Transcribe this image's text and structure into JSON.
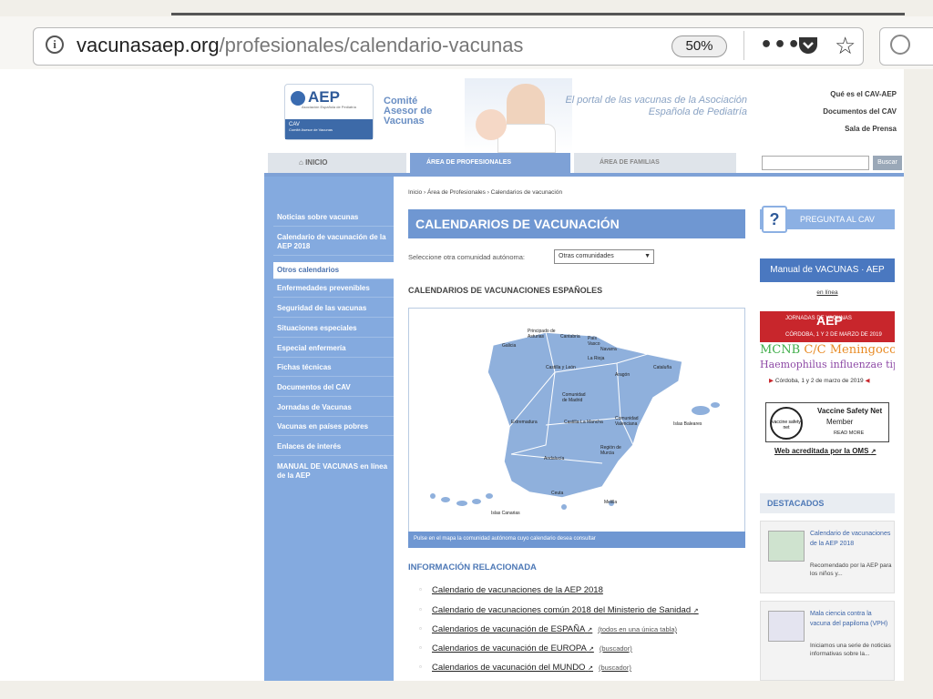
{
  "browser": {
    "url_host": "vacunasaep.org",
    "url_path": "/profesionales/calendario-vacunas",
    "zoom": "50%",
    "menu_dots": "•••"
  },
  "site": {
    "logo_text": "AEP",
    "logo_sub": "Asociación Española de Pediatría",
    "logo_cav": "CAV",
    "logo_cav_sub": "Comité Asesor de Vacunas",
    "comite_lines": [
      "Comité",
      "Asesor de",
      "Vacunas"
    ],
    "tagline": "El portal de las vacunas de la Asociación Española de Pediatría",
    "top_links": [
      "Qué es el CAV-AEP",
      "Documentos del CAV",
      "Sala de Prensa"
    ]
  },
  "nav": {
    "inicio": "INICIO",
    "profesionales": "ÁREA DE PROFESIONALES",
    "familias": "ÁREA DE FAMILIAS",
    "search_button": "Buscar"
  },
  "sidebar": {
    "items": [
      "Noticias sobre vacunas",
      "Calendario de vacunación de la AEP 2018",
      "Otros calendarios",
      "Enfermedades prevenibles",
      "Seguridad de las vacunas",
      "Situaciones especiales",
      "Especial enfermería",
      "Fichas técnicas",
      "Documentos del CAV",
      "Jornadas de Vacunas",
      "Vacunas en países pobres",
      "Enlaces de interés",
      "MANUAL DE VACUNAS en línea de la AEP"
    ]
  },
  "main": {
    "breadcrumb": "Inicio › Área de Profesionales › Calendarios de vacunación",
    "title": "CALENDARIOS DE VACUNACIÓN",
    "select_label": "Seleccione otra comunidad autónoma:",
    "select_value": "Otras comunidades",
    "section_title": "CALENDARIOS DE VACUNACIONES ESPAÑOLES",
    "map_caption": "Pulse en el mapa la comunidad autónoma cuyo calendario desea consultar",
    "map_regions": [
      "Principado de Asturias",
      "Cantabria",
      "País Vasco",
      "Galicia",
      "Navarra",
      "La Rioja",
      "Castilla y León",
      "Aragón",
      "Cataluña",
      "Comunidad de Madrid",
      "Extremadura",
      "Castilla-La Mancha",
      "Comunidad Valenciana",
      "Islas Baleares",
      "Región de Murcia",
      "Andalucía",
      "Ceuta",
      "Melilla",
      "Islas Canarias"
    ],
    "info_title": "INFORMACIÓN RELACIONADA",
    "related": [
      {
        "label": "Calendario de vacunaciones de la AEP 2018",
        "note": ""
      },
      {
        "label": "Calendario de vacunaciones común 2018 del Ministerio de Sanidad",
        "note": ""
      },
      {
        "label": "Calendarios de vacunación de ESPAÑA",
        "note": "(todos en una única tabla)"
      },
      {
        "label": "Calendarios de vacunación de EUROPA",
        "note": "(buscador)"
      },
      {
        "label": "Calendarios de vacunación del MUNDO",
        "note": "(buscador)"
      }
    ]
  },
  "right": {
    "pregunta": "PREGUNTA AL CAV",
    "manual": "Manual de VACUNAS · AEP",
    "en_linea": "en línea",
    "jornada_top": "JORNADAS DE VACUNAS",
    "jornada_aep": "AEP",
    "jornada_place": "CÓRDOBA, 1 Y 2 DE MARZO DE 2019",
    "jornada_line1_a": "MCNB",
    "jornada_line1_b": "C/C",
    "jornada_line1_c": "Meningococo C",
    "jornada_line2": "Haemophilus influenzae tipo b",
    "jornada_fecha": "Córdoba, 1 y 2 de marzo de 2019",
    "vsn_badge": "vaccine safety net",
    "vsn_title": "Vaccine Safety Net",
    "vsn_member": "Member",
    "vsn_more": "READ MORE",
    "oms": "Web acreditada por la OMS",
    "destacados": "DESTACADOS",
    "cards": [
      {
        "title": "Calendario de vacunaciones de la AEP 2018",
        "desc": "Recomendado por la AEP para los niños y..."
      },
      {
        "title": "Mala ciencia contra la vacuna del papiloma (VPH)",
        "desc": "Iniciamos una serie de noticias informativas sobre la..."
      }
    ]
  }
}
